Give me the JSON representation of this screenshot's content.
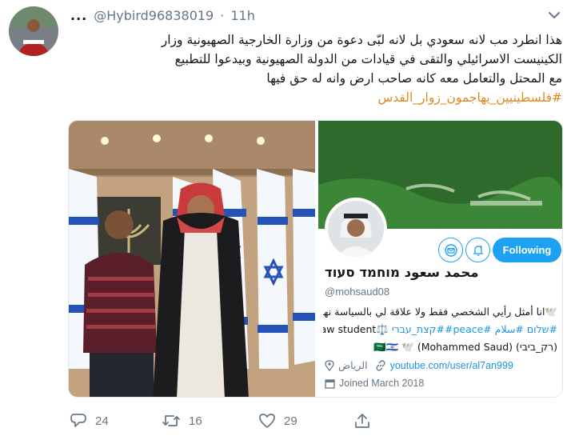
{
  "tweet": {
    "more": "...",
    "handle": "@Hybird96838019",
    "separator": "·",
    "time": "11h",
    "text_lines": [
      "هذا انطرد مب لانه سعودي بل  لانه لبّى دعوة من وزارة الخارجية الصهيونية وزار",
      "الكينيست الاسرائيلي والتقى في قيادات من الدولة الصهيونية وبيدعوا للتطبيع",
      "مع المحتل والتعامل معه كانه صاحب ارض وانه له حق فيها"
    ],
    "hashtag": "#فلسطينيين_يهاجمون_زوار_القدس"
  },
  "profile_card": {
    "follow_label": "Following",
    "name": "محمد سعود מוחמד סעוד",
    "handle": "@mohsaud08",
    "bio_line1": "🕊️انا أمثل رأيي الشخصي فقط ولا علاقة لي بالسياسة نهائياً",
    "bio_line2_law": "⚖️Law student",
    "bio_line2_tags": "#שלום #سلام #peace##קצת_עברי",
    "bio_line3": "(רק_ביבי) 🇸🇦🇮🇱 🕊️ (Mohammed Saud)",
    "location": "الرياض",
    "url": "youtube.com/user/al7an999",
    "joined": "Joined March 2018"
  },
  "actions": {
    "replies": "24",
    "retweets": "16",
    "likes": "29"
  },
  "colors": {
    "accent": "#1da1f2",
    "hashtag": "#e0891b",
    "muted": "#657786"
  },
  "icons": [
    "chevron-down-icon",
    "reply-icon",
    "retweet-icon",
    "like-icon",
    "share-icon",
    "mail-icon",
    "notification-bell-icon",
    "location-pin-icon",
    "link-icon",
    "calendar-icon"
  ]
}
